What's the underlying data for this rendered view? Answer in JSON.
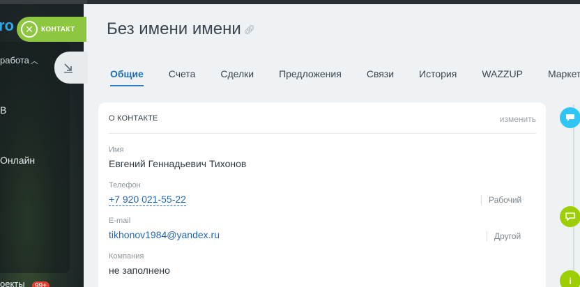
{
  "background": {
    "logo_fragment": "ro",
    "work_label": "работа",
    "item_b": "В",
    "online_label": "Онлайн",
    "bottom_label": "оекты",
    "bottom_badge": "99+"
  },
  "contact_pill": {
    "label": "КОНТАКТ"
  },
  "header": {
    "title": "Без имени имени"
  },
  "tabs": [
    {
      "label": "Общие",
      "active": true
    },
    {
      "label": "Счета"
    },
    {
      "label": "Сделки"
    },
    {
      "label": "Предложения"
    },
    {
      "label": "Связи"
    },
    {
      "label": "История"
    },
    {
      "label": "WAZZUP"
    },
    {
      "label": "Маркет"
    }
  ],
  "card": {
    "title": "О КОНТАКТЕ",
    "edit_label": "изменить",
    "fields": {
      "name": {
        "label": "Имя",
        "value": "Евгений Геннадьевич Тихонов"
      },
      "phone": {
        "label": "Телефон",
        "value": "+7 920 021-55-22",
        "type": "Рабочий"
      },
      "email": {
        "label": "E-mail",
        "value": "tikhonov1984@yandex.ru",
        "type": "Другой"
      },
      "company": {
        "label": "Компания",
        "value": "не заполнено"
      }
    }
  },
  "colors": {
    "accent_blue": "#2067b0",
    "contact_green": "#8dc63f",
    "timeline_blue": "#2fc6f6",
    "timeline_green": "#9dcf00"
  }
}
